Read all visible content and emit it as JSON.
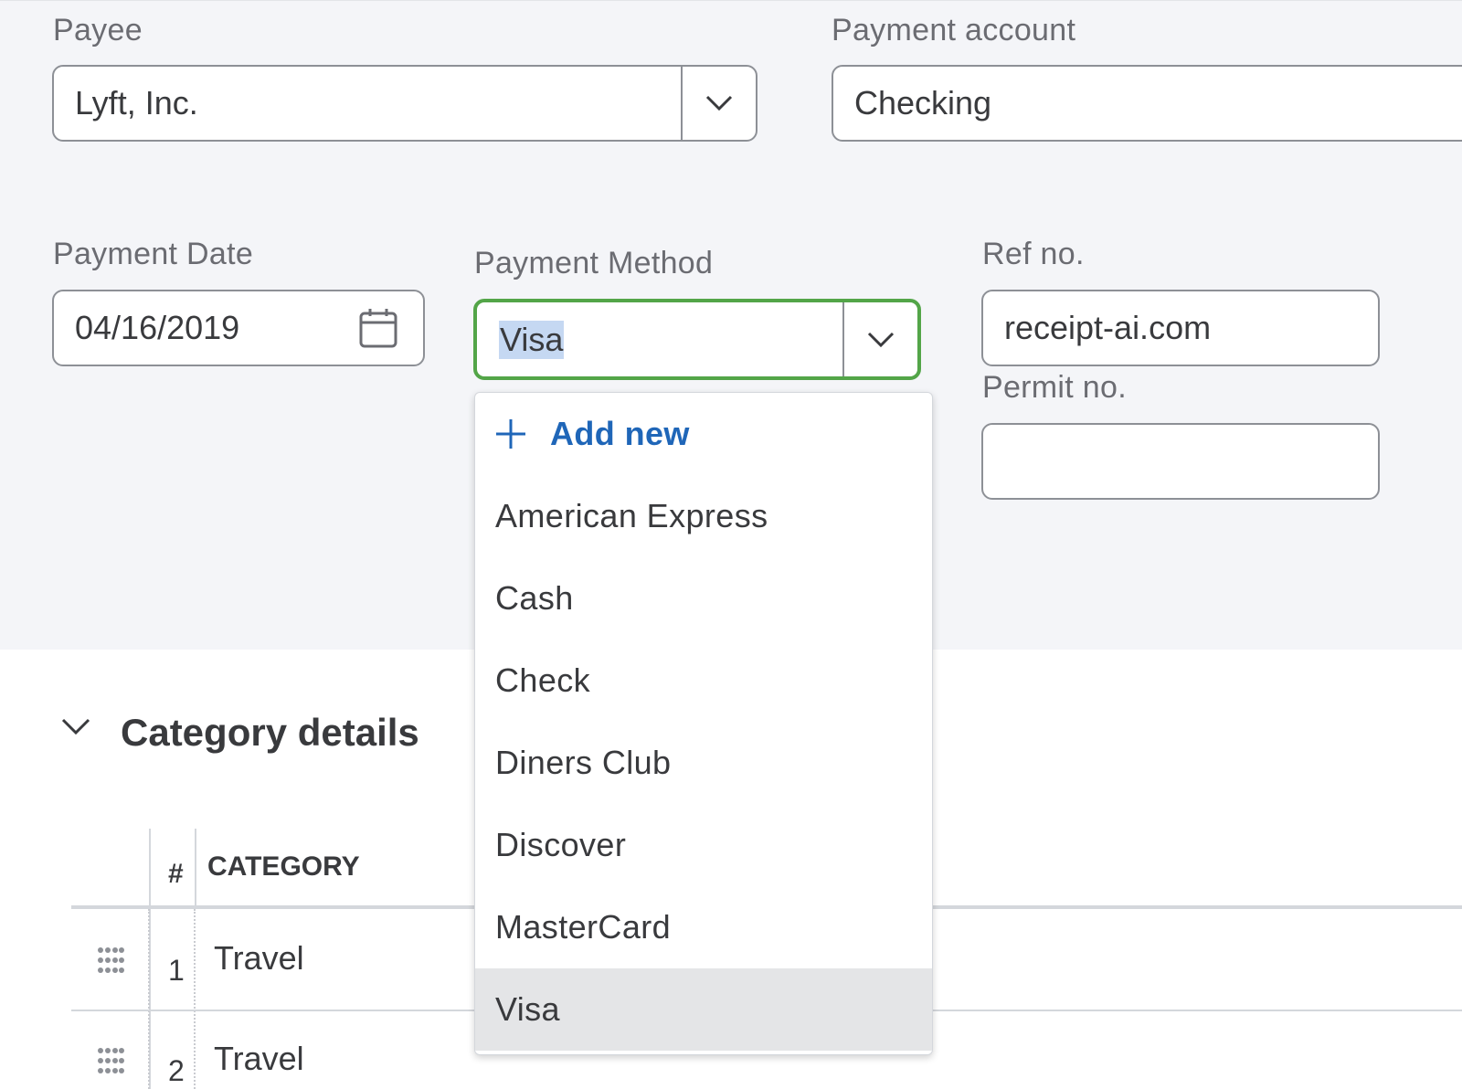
{
  "payee": {
    "label": "Payee",
    "value": "Lyft, Inc."
  },
  "payment_account": {
    "label": "Payment account",
    "value": "Checking"
  },
  "payment_date": {
    "label": "Payment Date",
    "value": "04/16/2019"
  },
  "payment_method": {
    "label": "Payment Method",
    "value": "Visa",
    "options": {
      "add_new": "Add new",
      "items": [
        "American Express",
        "Cash",
        "Check",
        "Diners Club",
        "Discover",
        "MasterCard",
        "Visa"
      ]
    }
  },
  "ref_no": {
    "label": "Ref no.",
    "value": "receipt-ai.com"
  },
  "permit_no": {
    "label": "Permit no.",
    "value": ""
  },
  "category_details": {
    "title": "Category details",
    "columns": {
      "num": "#",
      "category": "CATEGORY"
    },
    "rows": [
      {
        "num": "1",
        "category": "Travel"
      },
      {
        "num": "2",
        "category": "Travel"
      }
    ]
  },
  "colors": {
    "focus_border": "#53a548",
    "link_blue": "#1f66b8",
    "selection_highlight": "#c5d8f2",
    "selected_option_bg": "#e4e5e7"
  }
}
